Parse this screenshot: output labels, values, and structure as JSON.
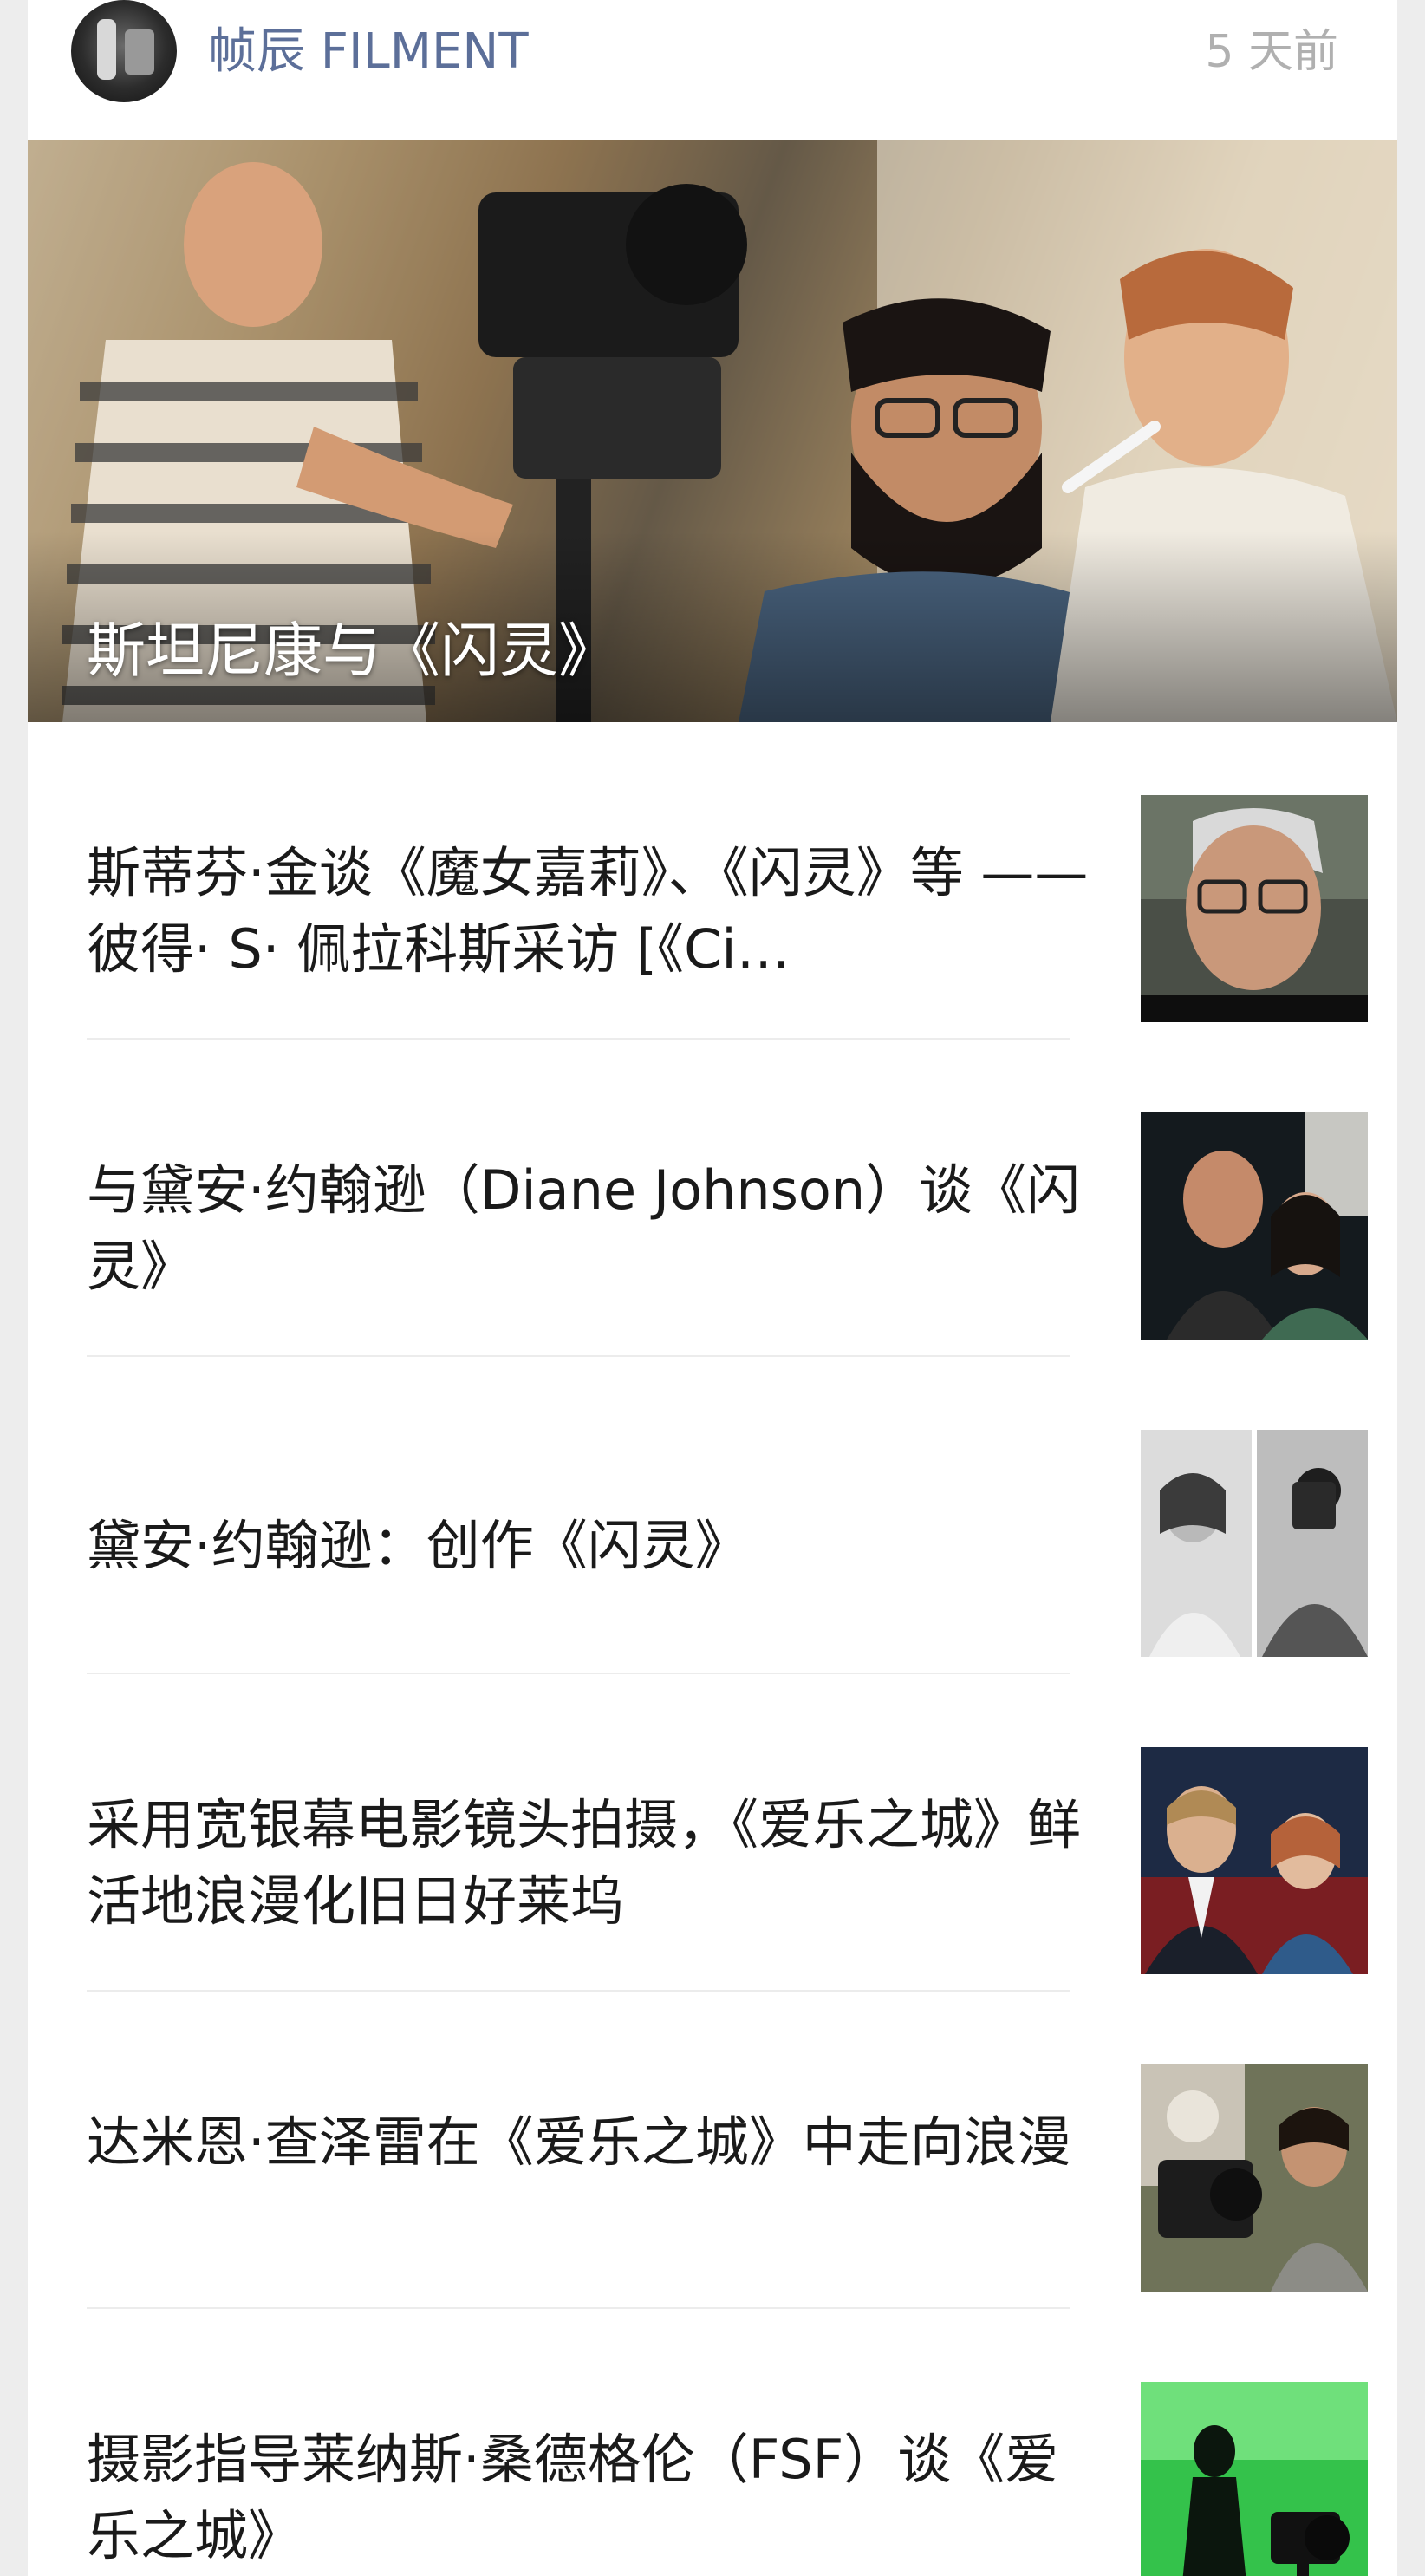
{
  "header": {
    "channel_name": "帧辰 FILMENT",
    "time_ago": "5 天前",
    "avatar_icon": "channel-avatar"
  },
  "hero": {
    "caption": "斯坦尼康与《闪灵》"
  },
  "articles": [
    {
      "title": "斯蒂芬·金谈《魔女嘉莉》、《闪灵》等 —— 彼得· S· 佩拉科斯采访 [《Ci…",
      "thumb": "portrait-man-glasses"
    },
    {
      "title": "与黛安·约翰逊（Diane Johnson）谈《闪灵》",
      "thumb": "film-still-couple"
    },
    {
      "title": "黛安·约翰逊：创作《闪灵》",
      "thumb": "bw-diptych"
    },
    {
      "title": "采用宽银幕电影镜头拍摄，《爱乐之城》鲜活地浪漫化旧日好莱坞",
      "thumb": "cinema-couple"
    },
    {
      "title": "达米恩·查泽雷在《爱乐之城》中走向浪漫",
      "thumb": "director-camera"
    },
    {
      "title": "摄影指导莱纳斯·桑德格伦（FSF）谈《爱乐之城》",
      "thumb": "greenscreen-silhouette"
    }
  ]
}
